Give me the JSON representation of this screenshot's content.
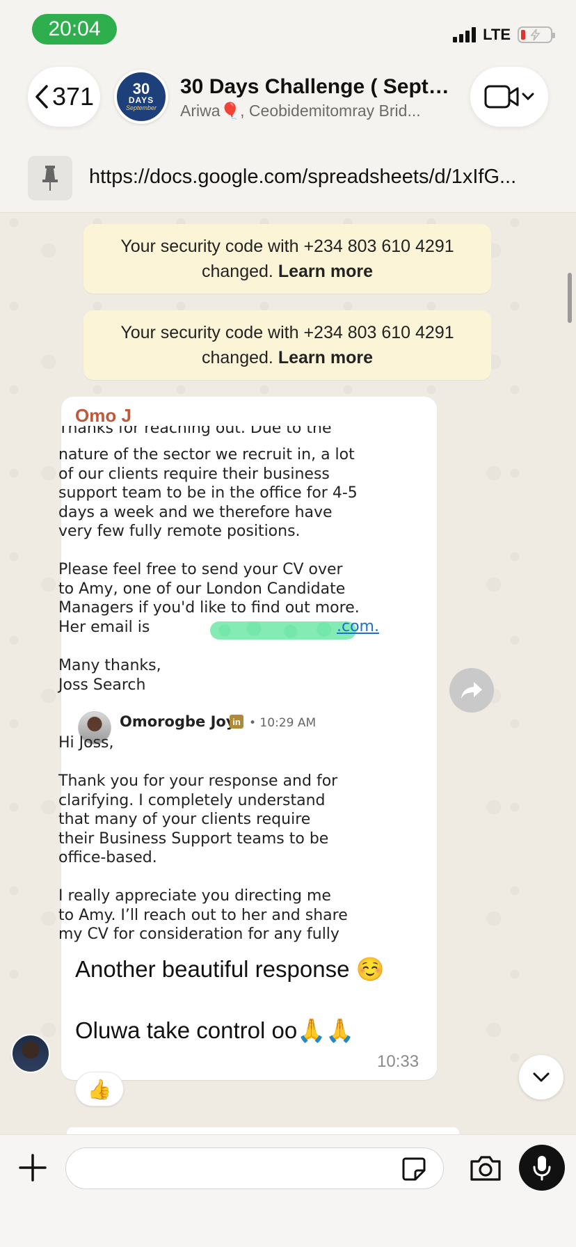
{
  "status_bar": {
    "time": "20:04",
    "network": "LTE",
    "battery_color": "#e5302f"
  },
  "header": {
    "back_count": "371",
    "avatar": {
      "line1": "30",
      "line2": "DAYS",
      "line3": "September"
    },
    "title": "30 Days Challenge ( Septe...",
    "subtitle": "Ariwa🎈, Ceobidemitomray Brid...",
    "icons": {
      "back": "chevron-left-icon",
      "video": "video-camera-icon",
      "dropdown": "chevron-down-icon"
    }
  },
  "pinned": {
    "text": "https://docs.google.com/spreadsheets/d/1xIfG...",
    "icon": "pin-icon"
  },
  "notices": [
    {
      "text": "Your security code with +234 803 610 4291 changed.",
      "link": "Learn more"
    },
    {
      "text": "Your security code with +234 803 610 4291 changed.",
      "link": "Learn more"
    }
  ],
  "message": {
    "sender": "Omo J",
    "sender_color": "#c0583b",
    "screenshot": {
      "para1": "Thanks for reaching out. Due to the\nnature of the sector we recruit in, a lot\nof our clients require their business\nsupport team to be in the office for 4-5\ndays a week and we therefore have\nvery few fully remote positions.",
      "para2": "Please feel free to send your CV over\nto Amy, one of our London Candidate\nManagers if you'd like to find out more.\nHer email is",
      "email_tail": ".com.",
      "para3": "Many thanks,\nJoss Search",
      "reply_name": "Omorogbe Joy",
      "reply_badge": "in",
      "reply_time": "• 10:29 AM",
      "reply_greeting": "Hi Joss,",
      "reply_para1": "Thank you for your response and for\nclarifying. I completely understand\nthat many of your clients require\ntheir Business Support teams to be\noffice-based.",
      "reply_para2": "I really appreciate you directing me\nto Amy. I’ll reach out to her and share\nmy CV for consideration for any fully"
    },
    "caption_line1": "Another beautiful response ☺️",
    "caption_line2": "Oluwa take control oo🙏🙏",
    "time": "10:33",
    "reaction": "👍"
  },
  "composer": {
    "input_value": "",
    "input_placeholder": "",
    "icons": {
      "add": "plus-icon",
      "sticker": "sticker-icon",
      "camera": "camera-icon",
      "mic": "microphone-icon"
    }
  }
}
